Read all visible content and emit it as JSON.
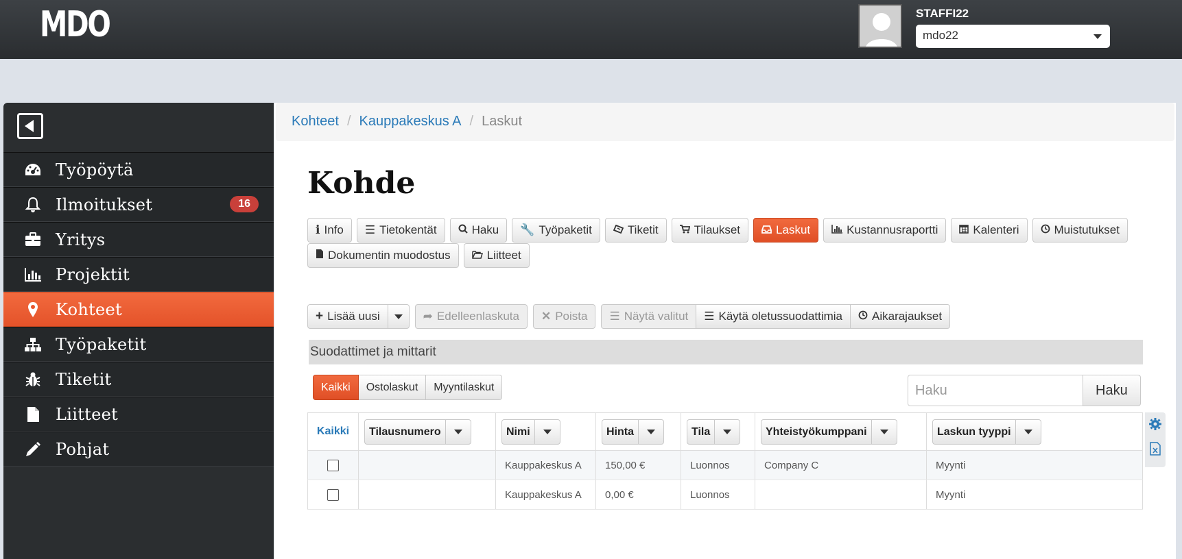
{
  "app": {
    "logo": "MDO"
  },
  "user": {
    "name": "STAFFI22",
    "account": "mdo22"
  },
  "sidebar": {
    "items": [
      {
        "label": "Työpöytä",
        "icon": "dashboard-icon"
      },
      {
        "label": "Ilmoitukset",
        "icon": "bell-icon",
        "badge": "16"
      },
      {
        "label": "Yritys",
        "icon": "briefcase-icon"
      },
      {
        "label": "Projektit",
        "icon": "bar-chart-icon"
      },
      {
        "label": "Kohteet",
        "icon": "map-marker-icon",
        "active": true
      },
      {
        "label": "Työpaketit",
        "icon": "sitemap-icon"
      },
      {
        "label": "Tiketit",
        "icon": "bug-icon"
      },
      {
        "label": "Liitteet",
        "icon": "file-icon"
      },
      {
        "label": "Pohjat",
        "icon": "pencil-icon"
      }
    ]
  },
  "breadcrumb": [
    "Kohteet",
    "Kauppakeskus A",
    "Laskut"
  ],
  "page": {
    "title": "Kohde"
  },
  "tabs": [
    {
      "label": "Info",
      "icon": "info-icon"
    },
    {
      "label": "Tietokentät",
      "icon": "list-icon"
    },
    {
      "label": "Haku",
      "icon": "search-icon"
    },
    {
      "label": "Työpaketit",
      "icon": "wrench-icon"
    },
    {
      "label": "Tiketit",
      "icon": "ticket-icon"
    },
    {
      "label": "Tilaukset",
      "icon": "cart-icon"
    },
    {
      "label": "Laskut",
      "icon": "inbox-icon",
      "active": true
    },
    {
      "label": "Kustannusraportti",
      "icon": "bar-chart-icon"
    },
    {
      "label": "Kalenteri",
      "icon": "calendar-icon"
    },
    {
      "label": "Muistutukset",
      "icon": "clock-icon"
    },
    {
      "label": "Dokumentin muodostus",
      "icon": "file-icon"
    },
    {
      "label": "Liitteet",
      "icon": "folder-open-icon"
    }
  ],
  "toolbar": {
    "add": "Lisää uusi",
    "forward": "Edelleenlaskuta",
    "delete": "Poista",
    "show_selected": "Näytä valitut",
    "default_filters": "Käytä oletussuodattimia",
    "time_limits": "Aikarajaukset"
  },
  "filters": {
    "title": "Suodattimet ja mittarit",
    "types": [
      "Kaikki",
      "Ostolaskut",
      "Myyntilaskut"
    ],
    "active_type": "Kaikki"
  },
  "search": {
    "placeholder": "Haku",
    "button": "Haku"
  },
  "table": {
    "select_all": "Kaikki",
    "columns": [
      "Tilausnumero",
      "Nimi",
      "Hinta",
      "Tila",
      "Yhteistyökumppani",
      "Laskun tyyppi"
    ],
    "rows": [
      {
        "order": "",
        "name": "Kauppakeskus A",
        "price": "150,00 €",
        "status": "Luonnos",
        "partner": "Company C",
        "type": "Myynti"
      },
      {
        "order": "",
        "name": "Kauppakeskus A",
        "price": "0,00 €",
        "status": "Luonnos",
        "partner": "",
        "type": "Myynti"
      }
    ]
  },
  "colors": {
    "accent": "#e8562d",
    "link": "#2a7ab8",
    "sidebar": "#25282a"
  }
}
